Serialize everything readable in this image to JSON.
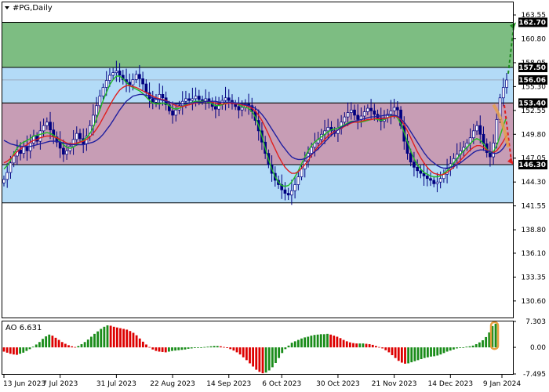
{
  "window": {
    "symbol_title": "#PG,Daily",
    "dropdown_icon": "triangle-down-icon"
  },
  "colors": {
    "zone_green": "#7dbd82",
    "zone_blue": "#b3dbf7",
    "zone_mauve": "#c79db5",
    "candle": "#000080",
    "ma_fast": "#22bb22",
    "ma_mid": "#e02020",
    "ma_slow": "#2020a0",
    "ao_up": "#1a8c1a",
    "ao_down": "#dd0000",
    "forecast_up": "#1c8a1c",
    "forecast_down": "#e02020",
    "highlight": "#e8a040"
  },
  "chart_data": [
    {
      "type": "candlestick",
      "title": "#PG,Daily",
      "ylim": [
        128.69,
        165.0
      ],
      "y_ticks": [
        "163.55",
        "160.80",
        "158.05",
        "155.30",
        "152.55",
        "149.80",
        "147.05",
        "144.30",
        "141.55",
        "138.80",
        "136.10",
        "133.35",
        "130.60"
      ],
      "x_ticks": [
        "13 Jun 2023",
        "7 Jul 2023",
        "31 Jul 2023",
        "22 Aug 2023",
        "14 Sep 2023",
        "6 Oct 2023",
        "30 Oct 2023",
        "21 Nov 2023",
        "14 Dec 2023",
        "9 Jan 2024"
      ],
      "zones": [
        {
          "from": 157.5,
          "to": 162.7,
          "color": "green"
        },
        {
          "from": 153.4,
          "to": 157.5,
          "color": "blue"
        },
        {
          "from": 146.3,
          "to": 153.4,
          "color": "mauve"
        },
        {
          "from": 141.9,
          "to": 146.3,
          "color": "blue"
        }
      ],
      "levels": [
        "162.70",
        "157.50",
        "156.06",
        "153.40",
        "146.30"
      ],
      "close": [
        144.6,
        145.4,
        146.5,
        147.3,
        148.0,
        147.6,
        148.4,
        147.9,
        148.8,
        149.6,
        149.0,
        150.2,
        150.8,
        151.2,
        150.3,
        149.5,
        148.9,
        148.2,
        147.5,
        147.9,
        148.4,
        149.2,
        149.9,
        149.3,
        148.7,
        149.6,
        150.8,
        152.0,
        153.1,
        154.2,
        155.2,
        156.0,
        156.6,
        156.9,
        157.1,
        156.6,
        156.1,
        155.8,
        155.5,
        156.1,
        156.7,
        156.2,
        155.6,
        154.6,
        153.9,
        153.5,
        153.8,
        154.4,
        154.0,
        153.2,
        152.5,
        152.0,
        152.6,
        153.1,
        153.6,
        153.9,
        153.7,
        153.9,
        154.2,
        153.8,
        153.6,
        153.9,
        153.5,
        153.0,
        152.7,
        153.2,
        153.7,
        154.0,
        153.7,
        153.3,
        153.0,
        152.6,
        152.9,
        153.3,
        153.1,
        152.4,
        151.4,
        150.2,
        148.9,
        147.6,
        146.3,
        145.3,
        144.5,
        144.0,
        143.4,
        143.0,
        142.8,
        143.3,
        144.0,
        144.9,
        145.8,
        146.7,
        147.6,
        148.3,
        148.8,
        149.2,
        149.8,
        150.2,
        150.6,
        150.2,
        149.9,
        150.5,
        151.2,
        151.8,
        152.3,
        152.6,
        152.0,
        151.5,
        151.9,
        152.4,
        152.8,
        152.5,
        152.1,
        151.7,
        151.3,
        151.7,
        152.1,
        152.5,
        152.9,
        152.6,
        150.8,
        149.0,
        147.6,
        146.6,
        146.0,
        145.6,
        145.3,
        145.0,
        144.7,
        144.5,
        144.1,
        144.3,
        144.7,
        145.2,
        145.8,
        146.4,
        147.0,
        147.5,
        147.9,
        148.3,
        148.8,
        149.4,
        150.2,
        150.8,
        149.8,
        148.7,
        147.7,
        147.2,
        148.8,
        151.5,
        154.0,
        155.2,
        156.06
      ],
      "series": [
        {
          "name": "",
          "role": "ma_fast",
          "values": [
            145.8,
            146.2,
            146.8,
            147.6,
            148.2,
            148.7,
            148.9,
            149.1,
            149.3,
            149.6,
            149.7,
            149.8,
            149.9,
            150.0,
            149.9,
            149.7,
            149.4,
            149.0,
            148.6,
            148.3,
            148.2,
            148.3,
            148.6,
            148.9,
            149.1,
            149.4,
            149.9,
            150.6,
            151.6,
            152.6,
            153.7,
            154.6,
            155.5,
            156.1,
            156.5,
            156.5,
            156.2,
            155.8,
            155.4,
            155.2,
            155.0,
            154.8,
            154.5,
            154.1,
            153.7,
            153.4,
            153.3,
            153.3,
            153.4,
            153.3,
            153.1,
            152.8,
            152.7,
            152.8,
            153.0,
            153.2,
            153.4,
            153.5,
            153.6,
            153.6,
            153.6,
            153.6,
            153.5,
            153.3,
            153.1,
            153.1,
            153.2,
            153.4,
            153.5,
            153.5,
            153.4,
            153.2,
            153.0,
            152.9,
            152.8,
            152.4,
            151.8,
            150.8,
            149.6,
            148.2,
            146.9,
            145.8,
            144.9,
            144.3,
            143.9,
            143.8,
            143.9,
            144.3,
            144.9,
            145.6,
            146.4,
            147.2,
            147.9,
            148.5,
            148.9,
            149.2,
            149.5,
            149.8,
            150.1,
            150.3,
            150.4,
            150.5,
            150.7,
            150.9,
            151.1,
            151.3,
            151.3,
            151.2,
            151.2,
            151.3,
            151.4,
            151.5,
            151.6,
            151.5,
            151.4,
            151.5,
            151.7,
            151.9,
            152.0,
            151.7,
            151.0,
            150.0,
            148.9,
            147.9,
            147.0,
            146.3,
            145.8,
            145.4,
            145.2,
            145.0,
            144.9,
            144.9,
            145.0,
            145.3,
            145.6,
            146.0,
            146.5,
            147.0,
            147.5,
            147.9,
            148.3,
            148.7,
            149.1,
            149.3,
            149.1,
            148.7,
            148.1,
            147.7,
            147.8,
            148.5,
            149.6,
            150.8,
            151.8
          ]
        },
        {
          "name": "",
          "role": "ma_mid",
          "values": [
            146.5,
            146.7,
            147.0,
            147.4,
            147.8,
            148.1,
            148.4,
            148.6,
            148.9,
            149.1,
            149.2,
            149.4,
            149.5,
            149.6,
            149.6,
            149.5,
            149.4,
            149.2,
            149.0,
            148.8,
            148.7,
            148.7,
            148.8,
            148.9,
            149.0,
            149.2,
            149.5,
            149.9,
            150.4,
            151.0,
            151.7,
            152.4,
            153.1,
            153.8,
            154.4,
            154.9,
            155.2,
            155.4,
            155.4,
            155.3,
            155.2,
            155.0,
            154.8,
            154.6,
            154.4,
            154.2,
            154.0,
            153.9,
            153.8,
            153.7,
            153.5,
            153.3,
            153.1,
            153.0,
            153.0,
            153.1,
            153.2,
            153.3,
            153.4,
            153.5,
            153.5,
            153.6,
            153.6,
            153.5,
            153.4,
            153.3,
            153.3,
            153.3,
            153.4,
            153.4,
            153.3,
            153.3,
            153.2,
            153.1,
            153.0,
            152.8,
            152.5,
            152.0,
            151.4,
            150.6,
            149.8,
            148.9,
            148.1,
            147.3,
            146.6,
            146.0,
            145.6,
            145.3,
            145.3,
            145.5,
            145.9,
            146.3,
            146.8,
            147.4,
            147.9,
            148.4,
            148.8,
            149.2,
            149.6,
            149.9,
            150.1,
            150.3,
            150.5,
            150.7,
            150.9,
            151.1,
            151.2,
            151.2,
            151.3,
            151.4,
            151.5,
            151.5,
            151.6,
            151.6,
            151.6,
            151.6,
            151.7,
            151.8,
            151.9,
            151.8,
            151.5,
            150.9,
            150.2,
            149.4,
            148.6,
            147.8,
            147.1,
            146.5,
            146.0,
            145.6,
            145.3,
            145.2,
            145.1,
            145.2,
            145.4,
            145.7,
            146.0,
            146.4,
            146.8,
            147.2,
            147.6,
            148.0,
            148.3,
            148.5,
            148.5,
            148.3,
            148.0,
            147.8,
            147.7,
            147.9,
            148.4,
            149.0,
            149.7
          ]
        },
        {
          "name": "",
          "role": "ma_slow",
          "values": [
            149.1,
            148.9,
            148.7,
            148.6,
            148.5,
            148.4,
            148.4,
            148.4,
            148.4,
            148.5,
            148.6,
            148.7,
            148.8,
            148.9,
            149.0,
            149.0,
            149.0,
            148.9,
            148.8,
            148.7,
            148.6,
            148.6,
            148.6,
            148.6,
            148.6,
            148.7,
            148.8,
            148.9,
            149.1,
            149.4,
            149.8,
            150.3,
            150.8,
            151.4,
            152.0,
            152.6,
            153.1,
            153.6,
            153.9,
            154.2,
            154.3,
            154.4,
            154.4,
            154.3,
            154.2,
            154.0,
            153.9,
            153.8,
            153.7,
            153.6,
            153.5,
            153.4,
            153.3,
            153.3,
            153.3,
            153.3,
            153.4,
            153.4,
            153.5,
            153.5,
            153.5,
            153.6,
            153.6,
            153.6,
            153.6,
            153.5,
            153.5,
            153.5,
            153.5,
            153.5,
            153.4,
            153.4,
            153.3,
            153.2,
            153.1,
            153.0,
            152.8,
            152.5,
            152.1,
            151.6,
            151.0,
            150.4,
            149.8,
            149.2,
            148.6,
            148.1,
            147.6,
            147.2,
            147.0,
            146.9,
            146.9,
            147.0,
            147.2,
            147.5,
            147.8,
            148.1,
            148.5,
            148.9,
            149.3,
            149.7,
            150.0,
            150.3,
            150.6,
            150.8,
            151.0,
            151.2,
            151.3,
            151.4,
            151.5,
            151.6,
            151.7,
            151.8,
            151.8,
            151.9,
            151.9,
            152.0,
            152.0,
            152.0,
            152.0,
            151.9,
            151.6,
            151.2,
            150.7,
            150.1,
            149.5,
            148.9,
            148.3,
            147.7,
            147.2,
            146.8,
            146.5,
            146.2,
            146.0,
            145.9,
            145.9,
            146.0,
            146.1,
            146.3,
            146.5,
            146.8,
            147.1,
            147.4,
            147.7,
            147.9,
            148.0,
            148.0,
            147.9,
            147.8,
            147.6,
            147.6,
            147.8,
            148.2,
            148.8
          ]
        }
      ],
      "forecast": {
        "up_target": 162.7,
        "down_target": 146.3
      }
    },
    {
      "type": "bar",
      "title": "AO 6.631",
      "ylim": [
        -7.495,
        7.303
      ],
      "y_ticks": [
        "7.303",
        "0.00",
        "-7.495"
      ],
      "values": [
        -1.2,
        -1.5,
        -1.8,
        -2.0,
        -2.1,
        -1.8,
        -1.5,
        -1.0,
        -0.5,
        0.2,
        0.8,
        1.5,
        2.4,
        3.1,
        3.6,
        3.3,
        2.7,
        2.1,
        1.5,
        1.0,
        0.6,
        0.3,
        0.1,
        0.4,
        0.9,
        1.5,
        2.2,
        3.0,
        3.8,
        4.5,
        5.2,
        5.8,
        6.2,
        6.1,
        5.8,
        5.6,
        5.4,
        5.2,
        5.0,
        4.6,
        4.1,
        3.4,
        2.5,
        1.6,
        0.8,
        0.1,
        -0.6,
        -1.0,
        -1.2,
        -1.3,
        -1.4,
        -1.2,
        -1.0,
        -0.9,
        -0.8,
        -0.7,
        -0.6,
        -0.4,
        -0.3,
        -0.2,
        -0.1,
        0.0,
        0.1,
        0.2,
        0.3,
        0.4,
        0.4,
        0.3,
        0.1,
        -0.2,
        -0.5,
        -0.9,
        -1.4,
        -2.0,
        -2.8,
        -3.6,
        -4.5,
        -5.4,
        -6.3,
        -6.9,
        -7.3,
        -7.1,
        -6.5,
        -5.6,
        -4.4,
        -3.0,
        -1.6,
        -0.5,
        0.5,
        1.3,
        1.7,
        2.1,
        2.5,
        2.8,
        3.0,
        3.3,
        3.5,
        3.6,
        3.7,
        3.7,
        3.8,
        3.6,
        3.3,
        3.0,
        2.6,
        2.1,
        1.7,
        1.4,
        1.2,
        1.1,
        1.1,
        1.1,
        1.0,
        0.9,
        0.7,
        0.4,
        0.1,
        -0.3,
        -0.8,
        -1.4,
        -2.2,
        -3.0,
        -3.8,
        -4.3,
        -4.6,
        -4.5,
        -4.2,
        -3.9,
        -3.6,
        -3.3,
        -3.0,
        -2.8,
        -2.6,
        -2.5,
        -2.3,
        -2.0,
        -1.6,
        -1.2,
        -0.9,
        -0.6,
        -0.3,
        -0.1,
        0.0,
        0.2,
        0.3,
        0.5,
        0.9,
        1.4,
        2.0,
        2.9,
        4.2,
        6.0,
        6.631
      ]
    }
  ]
}
